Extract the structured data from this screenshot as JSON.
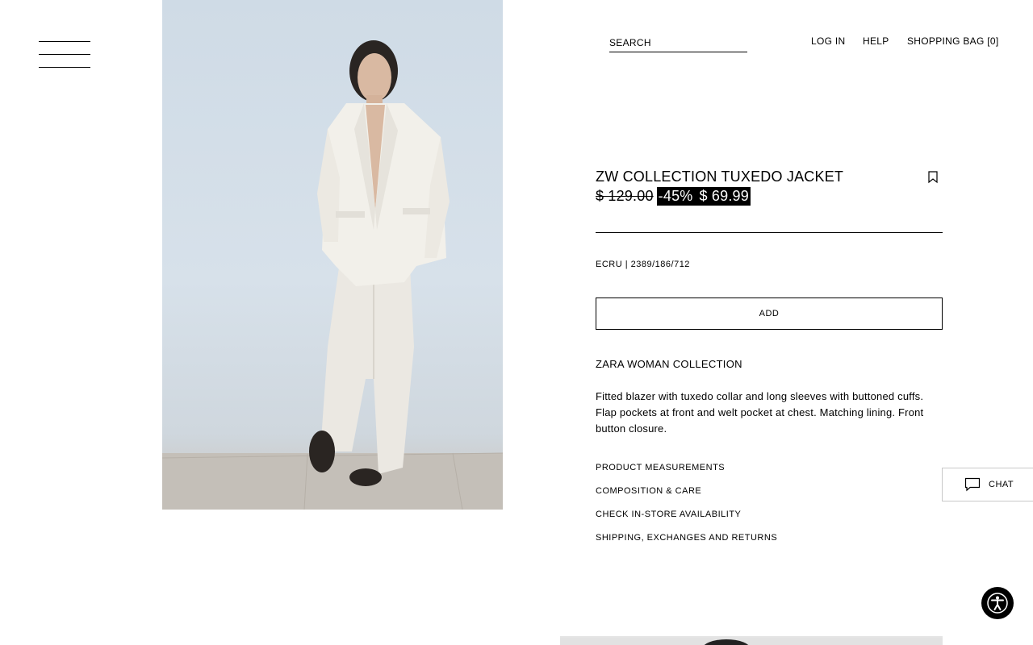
{
  "header": {
    "search_placeholder": "SEARCH",
    "login_label": "LOG IN",
    "help_label": "HELP",
    "bag_label": "SHOPPING BAG [0]"
  },
  "product": {
    "title": "ZW COLLECTION TUXEDO JACKET",
    "old_price": "$ 129.00",
    "discount": "-45%",
    "sale_price": "$ 69.99",
    "color_ref": "ECRU | 2389/186/712",
    "add_label": "ADD",
    "collection": "ZARA WOMAN COLLECTION",
    "description": "Fitted blazer with tuxedo collar and long sleeves with buttoned cuffs. Flap pockets at front and welt pocket at chest. Matching lining. Front button closure.",
    "info_links": [
      "PRODUCT MEASUREMENTS",
      "COMPOSITION & CARE",
      "CHECK IN-STORE AVAILABILITY",
      "SHIPPING, EXCHANGES AND RETURNS"
    ]
  },
  "chat": {
    "label": "CHAT"
  },
  "icons": {
    "menu": "hamburger-menu-icon",
    "bookmark": "bookmark-icon",
    "chat": "chat-bubble-icon",
    "accessibility": "accessibility-icon"
  },
  "colors": {
    "text": "#000000",
    "background": "#ffffff",
    "sale_badge_bg": "#000000",
    "sale_badge_text": "#ffffff"
  }
}
